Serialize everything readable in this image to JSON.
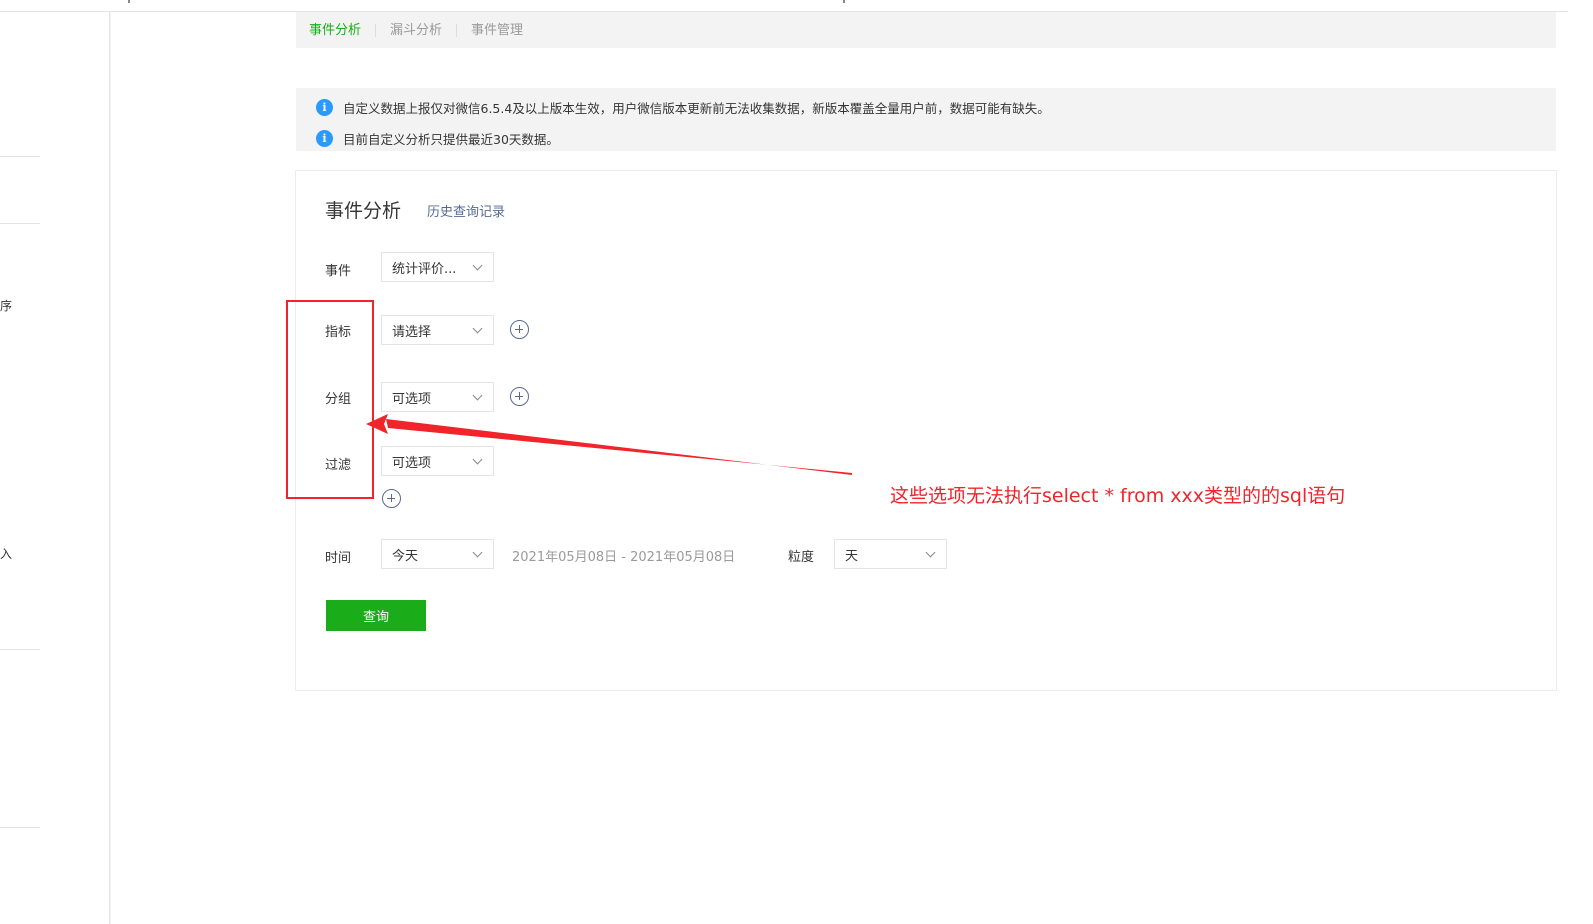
{
  "tabs": [
    {
      "label": "事件分析",
      "active": true
    },
    {
      "label": "漏斗分析",
      "active": false
    },
    {
      "label": "事件管理",
      "active": false
    }
  ],
  "sidebar_fragments": [
    {
      "text": "序"
    },
    {
      "text": "入"
    }
  ],
  "notices": [
    {
      "icon": "info-icon",
      "text": "自定义数据上报仅对微信6.5.4及以上版本生效，用户微信版本更新前无法收集数据，新版本覆盖全量用户前，数据可能有缺失。"
    },
    {
      "icon": "info-icon",
      "text": "目前自定义分析只提供最近30天数据。"
    }
  ],
  "card": {
    "title": "事件分析",
    "history_link": "历史查询记录"
  },
  "form": {
    "event_label": "事件",
    "event_value": "统计评价...",
    "metric_label": "指标",
    "metric_value": "请选择",
    "group_label": "分组",
    "group_value": "可选项",
    "filter_label": "过滤",
    "filter_value": "可选项",
    "time_label": "时间",
    "time_value": "今天",
    "date_range": "2021年05月08日 - 2021年05月08日",
    "granularity_label": "粒度",
    "granularity_value": "天",
    "query_button": "查询"
  },
  "annotation": {
    "text": "这些选项无法执行select * from xxx类型的的sql语句",
    "color": "#f0242a"
  },
  "colors": {
    "accent_green": "#1aad19",
    "link_blue": "#576b95",
    "info_blue": "#2a9bfd"
  }
}
